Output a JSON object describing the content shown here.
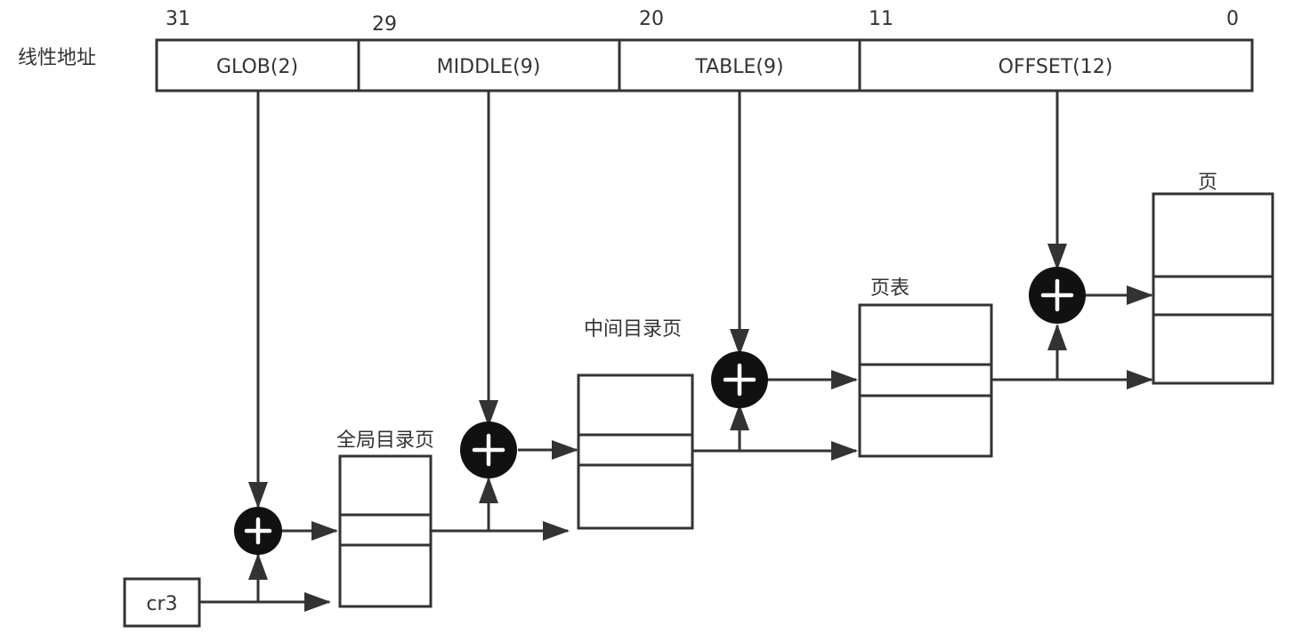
{
  "linear_address_label": "线性地址",
  "bit_positions": [
    "31",
    "29",
    "20",
    "11",
    "0"
  ],
  "fields": [
    {
      "name": "GLOB(2)"
    },
    {
      "name": "MIDDLE(9)"
    },
    {
      "name": "TABLE(9)"
    },
    {
      "name": "OFFSET(12)"
    }
  ],
  "register_label": "cr3",
  "tables": [
    {
      "label": "全局目录页"
    },
    {
      "label": "中间目录页"
    },
    {
      "label": "页表"
    },
    {
      "label": "页"
    }
  ],
  "adder_symbol": "+"
}
